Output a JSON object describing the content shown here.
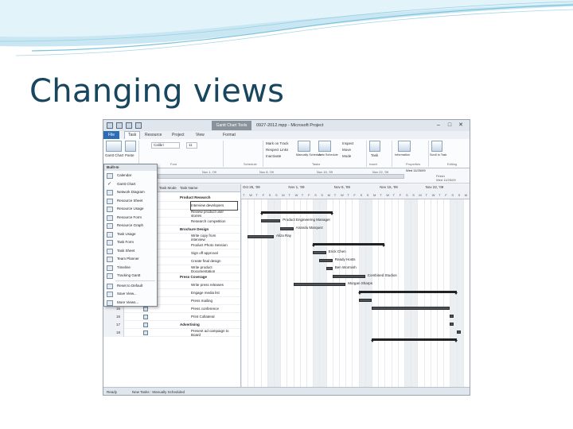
{
  "slide": {
    "title": "Changing views",
    "accent": "#17465e"
  },
  "app": {
    "tools_tab": "Gantt Chart Tools",
    "window_title": "0927-2012.mpp - Microsoft Project",
    "tabs": {
      "file": "File",
      "task": "Task",
      "resource": "Resource",
      "project": "Project",
      "view": "View",
      "format": "Format"
    },
    "ribbon": {
      "gantt_chart": "Gantt Chart",
      "paste": "Paste",
      "font_name": "Calibri",
      "font_size": "11",
      "mark_on_track": "Mark on Track",
      "respect_links": "Respect Links",
      "inactivate": "Inactivate",
      "manually_schedule": "Manually Schedule",
      "auto_schedule": "Auto Schedule",
      "inspect": "Inspect",
      "move": "Move",
      "mode": "Mode",
      "task": "Task",
      "information": "Information",
      "scroll_to_task": "Scroll to Task",
      "groups": {
        "font": "Font",
        "schedule": "Schedule",
        "tasks": "Tasks",
        "insert": "Insert",
        "properties": "Properties",
        "editing": "Editing"
      }
    },
    "timeline": {
      "start_label": "Wed 11/25/09",
      "dates": [
        "Nov 1, '09",
        "Nov 8, '09",
        "Nov 15, '09",
        "Nov 22, '09"
      ],
      "finish": "Finish",
      "finish_date": "Wed 11/25/09"
    },
    "grid": {
      "headers": {
        "mode": "Task Mode",
        "name": "Task Name"
      },
      "rows": [
        {
          "id": "1",
          "name": "Product Research",
          "bold": true
        },
        {
          "id": "2",
          "name": "Interview developers",
          "selected": true
        },
        {
          "id": "3",
          "name": "Review product user",
          "line2": "stories"
        },
        {
          "id": "4",
          "name": "Research competition"
        },
        {
          "id": "5",
          "name": "Brochure Design",
          "bold": true
        },
        {
          "id": "6",
          "name": "Write copy from",
          "line2": "interview"
        },
        {
          "id": "7",
          "name": "Product Photo Session"
        },
        {
          "id": "8",
          "name": "Sign off approval"
        },
        {
          "id": "9",
          "name": "Create final design"
        },
        {
          "id": "10",
          "name": "Write product",
          "line2": "Documentation"
        },
        {
          "id": "11",
          "name": "Press Coverage",
          "bold": true
        },
        {
          "id": "12",
          "name": "Write press releases"
        },
        {
          "id": "13",
          "name": "Engage media list"
        },
        {
          "id": "14",
          "name": "Press mailing"
        },
        {
          "id": "15",
          "name": "Press conference"
        },
        {
          "id": "16",
          "name": "Print Collateral"
        },
        {
          "id": "17",
          "name": "Advertising",
          "bold": true
        },
        {
          "id": "18",
          "name": "Present ad campaign to",
          "line2": "Board"
        }
      ]
    },
    "gantt": {
      "weeks": [
        "Oct 25, '09",
        "Nov 1, '09",
        "Nov 8, '09",
        "Nov 15, '09",
        "Nov 22, '09"
      ],
      "days": [
        "T",
        "W",
        "T",
        "F",
        "S",
        "S",
        "M",
        "T",
        "W",
        "T",
        "F",
        "S",
        "S",
        "M",
        "T",
        "W",
        "T",
        "F",
        "S",
        "S",
        "M",
        "T",
        "W",
        "T",
        "F",
        "S",
        "S",
        "M",
        "T",
        "W",
        "T",
        "F",
        "S",
        "S",
        "M"
      ],
      "resources": {
        "r1": "Product Engineering Manager",
        "r2": "Anandu Marquez",
        "r3": "Aliza Ray",
        "r4": "Erick Chen",
        "r5": "Ready Hosts",
        "r6": "Ben Wormish",
        "r7": "Combined Studios",
        "r8": "Morgan Sharps"
      }
    },
    "view_menu": {
      "header": "Built-In",
      "items": [
        "Calendar",
        "Gantt Chart",
        "Network Diagram",
        "Resource Sheet",
        "Resource Usage",
        "Resource Form",
        "Resource Graph",
        "Task Usage",
        "Task Form",
        "Task Sheet",
        "Team Planner",
        "Timeline",
        "Tracking Gantt",
        "Reset to Default",
        "Save View...",
        "More Views..."
      ],
      "checked_item": "Gantt Chart"
    },
    "status": {
      "ready": "Ready",
      "new_tasks": "New Tasks : Manually Scheduled"
    }
  }
}
